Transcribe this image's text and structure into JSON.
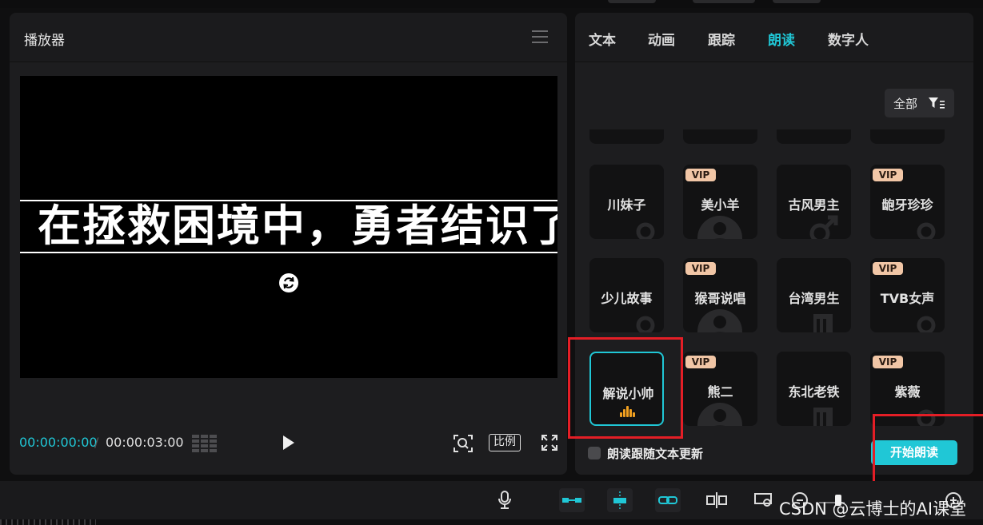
{
  "player": {
    "title": "播放器",
    "subtitle": "在拯救困境中，勇者结识了",
    "current_time": "00:00:00:00",
    "time_separator": "/",
    "total_time": "00:00:03:00",
    "ratio_label": "比例"
  },
  "tabs": [
    {
      "label": "文本",
      "active": false
    },
    {
      "label": "动画",
      "active": false
    },
    {
      "label": "跟踪",
      "active": false
    },
    {
      "label": "朗读",
      "active": true
    },
    {
      "label": "数字人",
      "active": false
    }
  ],
  "filter": {
    "label": "全部"
  },
  "voices": [
    {
      "name": "川妹子",
      "vip": false,
      "icon": "female-symbol-icon"
    },
    {
      "name": "美小羊",
      "vip": true,
      "icon": "clown-face-icon"
    },
    {
      "name": "古风男主",
      "vip": false,
      "icon": "male-symbol-icon"
    },
    {
      "name": "龅牙珍珍",
      "vip": true,
      "icon": "female-symbol-icon"
    },
    {
      "name": "少儿故事",
      "vip": false,
      "icon": "female-symbol-icon"
    },
    {
      "name": "猴哥说唱",
      "vip": true,
      "icon": "clown-face-icon"
    },
    {
      "name": "台湾男生",
      "vip": false,
      "icon": "book-icon"
    },
    {
      "name": "TVB女声",
      "vip": true,
      "icon": "female-symbol-icon"
    },
    {
      "name": "解说小帅",
      "vip": false,
      "icon": "audio-wave-icon",
      "selected": true
    },
    {
      "name": "熊二",
      "vip": true,
      "icon": "clown-face-icon"
    },
    {
      "name": "东北老铁",
      "vip": false,
      "icon": "book-icon"
    },
    {
      "name": "紫薇",
      "vip": true,
      "icon": "female-symbol-icon"
    }
  ],
  "vip_label": "VIP",
  "footer": {
    "checkbox_label": "朗读跟随文本更新",
    "start_button": "开始朗读"
  },
  "watermark": "CSDN @云博士的AI课堂",
  "colors": {
    "accent": "#20c7d6",
    "vip": "#f1c6a6",
    "annotation": "#e41e26",
    "wave": "#f0a020"
  }
}
